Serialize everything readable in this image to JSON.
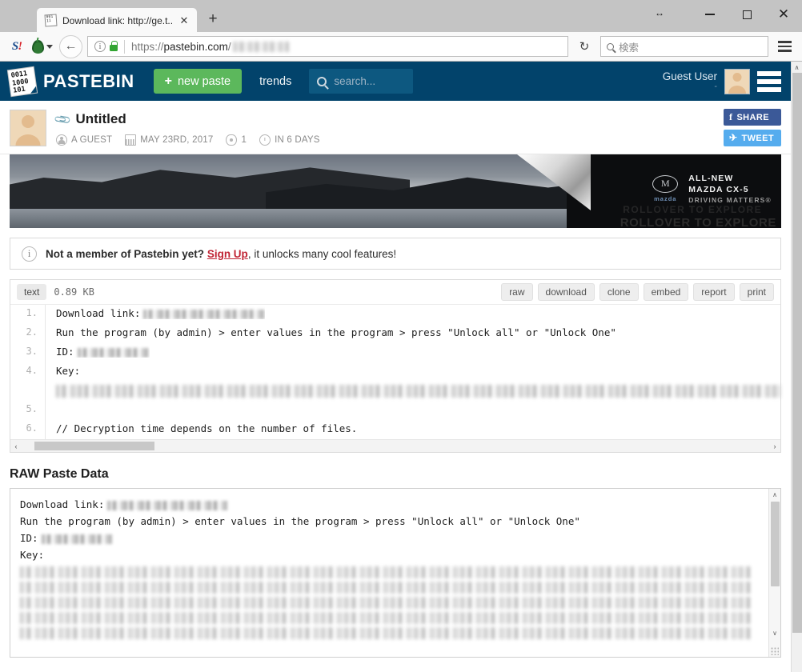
{
  "browser": {
    "tab": {
      "title": "Download link: http://ge.t...",
      "favicon_text": "001 11",
      "close_label": "✕"
    },
    "new_tab_label": "+",
    "window_controls": {
      "drag": "↔",
      "minimize": "–",
      "restore": "□",
      "close": "✕"
    },
    "toolbar": {
      "stumbleupon_label": "S",
      "stumbleupon_bang": "!",
      "back_label": "←",
      "reload_label": "↻",
      "url_scheme": "https://",
      "url_host": "pastebin.com",
      "url_separator": "/",
      "search_placeholder": "検索"
    }
  },
  "site": {
    "logo_text": "PASTEBIN",
    "logo_binary": "0011 1000 101",
    "nav": {
      "new_paste": "new paste",
      "new_paste_plus": "+",
      "trends": "trends",
      "search_placeholder": "search..."
    },
    "account": {
      "name": "Guest User",
      "dash": "-"
    }
  },
  "paste": {
    "title": "Untitled",
    "meta": {
      "author": "A GUEST",
      "date": "MAY 23RD, 2017",
      "views": "1",
      "expires": "IN 6 DAYS"
    },
    "share": {
      "facebook": "SHARE",
      "facebook_glyph": "f",
      "twitter": "TWEET",
      "twitter_glyph": "✈"
    }
  },
  "ad": {
    "line1": "ALL-NEW",
    "line2": "MAZDA CX-5",
    "line3": "DRIVING MATTERS®",
    "brand_word": "mazda",
    "rollover": "ROLLOVER TO EXPLORE",
    "ghost": "ROLLOVER TO EXPLORE"
  },
  "notice": {
    "lead": "Not a member of Pastebin yet?",
    "link": "Sign Up",
    "tail": ", it unlocks many cool features!",
    "icon": "i"
  },
  "toolbar": {
    "language": "text",
    "size": "0.89 KB",
    "actions": [
      "raw",
      "download",
      "clone",
      "embed",
      "report",
      "print"
    ]
  },
  "code": {
    "lines": [
      {
        "num": "1.",
        "text": "Download link:",
        "blur": 152
      },
      {
        "num": "2.",
        "text": "Run the program (by admin) > enter values in the program > press \"Unlock all\" or \"Unlock One\"",
        "blur": 0
      },
      {
        "num": "3.",
        "text": "ID:",
        "blur": 90
      },
      {
        "num": "4.",
        "text": "Key:",
        "blur": 0
      },
      {
        "num": "5.",
        "text": "",
        "blur": 0
      },
      {
        "num": "6.",
        "text": "// Decryption time depends on the number of files.",
        "blur": 0
      }
    ],
    "scroll_left": "‹",
    "scroll_right": "›"
  },
  "raw": {
    "heading": "RAW Paste Data",
    "lines": [
      {
        "text": "Download link:",
        "blur": 150
      },
      {
        "text": "Run the program (by admin) > enter values in the program > press \"Unlock all\" or \"Unlock One\"",
        "blur": 0
      },
      {
        "text": "ID:",
        "blur": 88
      },
      {
        "text": "Key:",
        "blur": 0
      }
    ],
    "blur_rows": 5,
    "scroll_up": "∧",
    "scroll_down": "∨"
  },
  "page_scroll": {
    "up": "∧"
  },
  "colors": {
    "header_blue": "#02436b",
    "green_button": "#5cb85c",
    "facebook": "#3b5998",
    "twitter": "#55acee",
    "link_red": "#c02434"
  }
}
